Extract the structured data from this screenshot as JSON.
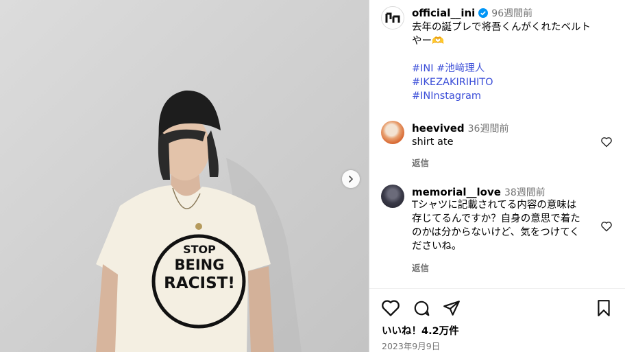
{
  "post": {
    "username": "official__ini",
    "time": "96週間前",
    "caption_line1": "去年の誕プレで将吾くんがくれたベルト",
    "caption_line2": "やー🫶",
    "hashtags": [
      "#INI #池﨑理人",
      "#IKEZAKIRIHITO",
      "#INInstagram"
    ]
  },
  "shirt": {
    "line1": "STOP",
    "line2": "BEING",
    "line3": "RACIST!"
  },
  "comments": [
    {
      "username": "heevived",
      "time": "36週間前",
      "lines": [
        "shirt ate"
      ],
      "reply_label": "返信"
    },
    {
      "username": "memorial__love",
      "time": "38週間前",
      "lines": [
        "Tシャツに記載されてる内容の意味は",
        "存じてるんですか？自身の意思で着た",
        "のかは分からないけど、気をつけてく",
        "ださいね。"
      ],
      "reply_label": "返信"
    }
  ],
  "likes": "いいね！4.2万件",
  "date": "2023年9月9日",
  "colors": {
    "hashtag": "#3b4ed8",
    "verified": "#0095f6",
    "muted": "#737373"
  }
}
